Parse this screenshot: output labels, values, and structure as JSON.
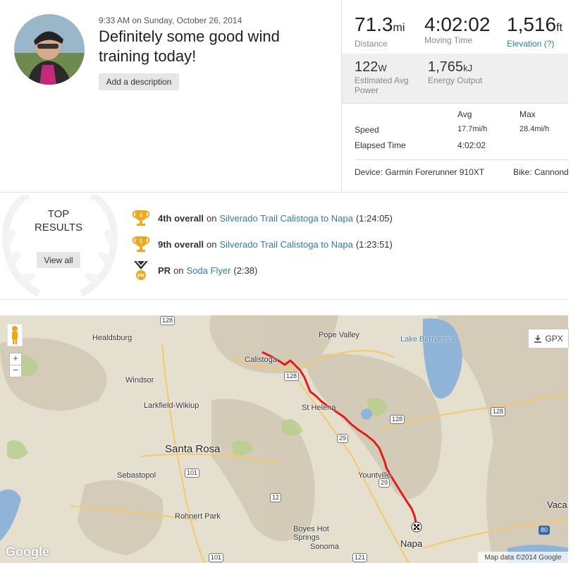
{
  "activity": {
    "timestamp": "9:33 AM on Sunday, October 26, 2014",
    "title": "Definitely some good wind training today!",
    "add_description_label": "Add a description"
  },
  "stats": {
    "distance": {
      "value": "71.3",
      "unit": "mi",
      "label": "Distance"
    },
    "moving_time": {
      "value": "4:02:02",
      "label": "Moving Time"
    },
    "elevation": {
      "value": "1,516",
      "unit": "ft",
      "label": "Elevation (?)"
    },
    "power": {
      "value": "122",
      "unit": "W",
      "label": "Estimated Avg Power"
    },
    "energy": {
      "value": "1,765",
      "unit": "kJ",
      "label": "Energy Output"
    },
    "table": {
      "headers": [
        "Avg",
        "Max"
      ],
      "rows": [
        {
          "label": "Speed",
          "avg": "17.7mi/h",
          "max": "28.4mi/h"
        },
        {
          "label": "Elapsed Time",
          "avg": "4:02:02",
          "max": ""
        }
      ]
    },
    "device": "Device: Garmin Forerunner 910XT",
    "bike": "Bike: Cannond"
  },
  "top_results": {
    "title_line1": "TOP",
    "title_line2": "RESULTS",
    "view_all_label": "View all",
    "items": [
      {
        "rank_badge": "4",
        "rank": "4th overall",
        "on": "on",
        "segment": "Silverado Trail Calistoga to Napa",
        "time": "(1:24:05)"
      },
      {
        "rank_badge": "9",
        "rank": "9th overall",
        "on": "on",
        "segment": "Silverado Trail Calistoga to Napa",
        "time": "(1:23:51)"
      },
      {
        "rank_badge": "PR",
        "rank": "PR",
        "on": "on",
        "segment": "Soda Flyer",
        "time": "(2:38)"
      }
    ]
  },
  "map": {
    "gpx_label": "GPX",
    "zoom_in": "+",
    "zoom_out": "−",
    "attribution": "Map data ©2014 Google",
    "logo": "Google",
    "places": {
      "healdsburg": "Healdsburg",
      "pope_valley": "Pope Valley",
      "lake_berryessa": "Lake Berryessa",
      "calistoga": "Calistoga",
      "windsor": "Windsor",
      "larkfield": "Larkfield-Wikiup",
      "st_helena": "St Helena",
      "santa_rosa": "Santa Rosa",
      "sebastopol": "Sebastopol",
      "yountville": "Yountville",
      "rohnert_park": "Rohnert Park",
      "boyes": "Boyes Hot Springs",
      "sonoma": "Sonoma",
      "napa": "Napa",
      "vaca": "Vaca"
    },
    "shields": {
      "r128a": "128",
      "r128b": "128",
      "r128c": "128",
      "r128d": "128",
      "r29a": "29",
      "r29b": "29",
      "r101a": "101",
      "r101b": "101",
      "r80": "80",
      "r12": "12",
      "r121": "121"
    },
    "colors": {
      "route": "#e31b1b",
      "water": "#8fb4d8",
      "land": "#e8e4d6",
      "park": "#b9cf8e"
    }
  }
}
